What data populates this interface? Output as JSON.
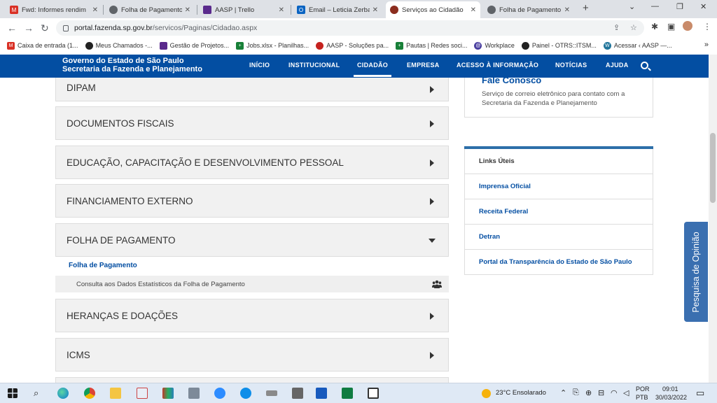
{
  "browser": {
    "tabs": [
      {
        "title": "Fwd: Informes rendim",
        "icon": "gmail-icon",
        "color": "#d93025",
        "active": false
      },
      {
        "title": "Folha de Pagamento",
        "icon": "globe-icon",
        "color": "#5f6368",
        "active": false
      },
      {
        "title": "AASP | Trello",
        "icon": "trello-icon",
        "color": "#5a2a8c",
        "active": false
      },
      {
        "title": "Email – Leticia Zerbat",
        "icon": "outlook-icon",
        "color": "#0a64c2",
        "active": false
      },
      {
        "title": "Serviços ao Cidadão",
        "icon": "sp-crest-icon",
        "color": "#8b2d1e",
        "active": true
      },
      {
        "title": "Folha de Pagamento",
        "icon": "globe-icon",
        "color": "#5f6368",
        "active": false
      }
    ],
    "url_host": "portal.fazenda.sp.gov.br",
    "url_path": "/servicos/Paginas/Cidadao.aspx",
    "bookmarks": [
      {
        "label": "Caixa de entrada (1...",
        "icon": "gmail-icon",
        "color": "#d93025"
      },
      {
        "label": "Meus Chamados -...",
        "icon": "aasp-icon",
        "color": "#222"
      },
      {
        "label": "Gestão de Projetos...",
        "icon": "trello-icon",
        "color": "#5a2a8c"
      },
      {
        "label": "Jobs.xlsx - Planilhas...",
        "icon": "sheets-icon",
        "color": "#188038"
      },
      {
        "label": "AASP - Soluções pa...",
        "icon": "aasp-red-icon",
        "color": "#c5221f"
      },
      {
        "label": "Pautas | Redes soci...",
        "icon": "sheets-icon",
        "color": "#188038"
      },
      {
        "label": "Workplace",
        "icon": "workplace-icon",
        "color": "#4a3fa0"
      },
      {
        "label": "Painel - OTRS::ITSM...",
        "icon": "aasp-icon",
        "color": "#222"
      },
      {
        "label": "Acessar ‹ AASP —...",
        "icon": "wordpress-icon",
        "color": "#21759b"
      }
    ]
  },
  "site": {
    "brand_line1": "Governo do Estado de São Paulo",
    "brand_line2": "Secretaria da Fazenda e Planejamento",
    "menu": [
      "INÍCIO",
      "INSTITUCIONAL",
      "CIDADÃO",
      "EMPRESA",
      "ACESSO À INFORMAÇÃO",
      "NOTÍCIAS",
      "AJUDA"
    ],
    "selected_menu": "CIDADÃO"
  },
  "accordion": [
    {
      "label": "DIPAM",
      "expanded": false
    },
    {
      "label": "DOCUMENTOS FISCAIS",
      "expanded": false
    },
    {
      "label": "EDUCAÇÃO, CAPACITAÇÃO E DESENVOLVIMENTO PESSOAL",
      "expanded": false
    },
    {
      "label": "FINANCIAMENTO EXTERNO",
      "expanded": false
    },
    {
      "label": "FOLHA DE PAGAMENTO",
      "expanded": true
    },
    {
      "label": "HERANÇAS E DOAÇÕES",
      "expanded": false
    },
    {
      "label": "ICMS",
      "expanded": false
    }
  ],
  "expanded_section": {
    "link": "Folha de Pagamento",
    "item": "Consulta aos Dados Estatísticos da Folha de Pagamento"
  },
  "contact": {
    "title": "Fale Conosco",
    "text": "Serviço de correio eletrônico para contato com a Secretaria da Fazenda e Planejamento"
  },
  "useful_links": {
    "heading": "Links Úteis",
    "items": [
      "Imprensa Oficial",
      "Receita Federal",
      "Detran",
      "Portal da Transparência do Estado de São Paulo"
    ]
  },
  "feedback_tab": "Pesquisa de Opinião",
  "taskbar": {
    "weather": "23°C  Ensolarado",
    "lang1": "POR",
    "lang2": "PTB",
    "time": "09:01",
    "date": "30/03/2022"
  }
}
